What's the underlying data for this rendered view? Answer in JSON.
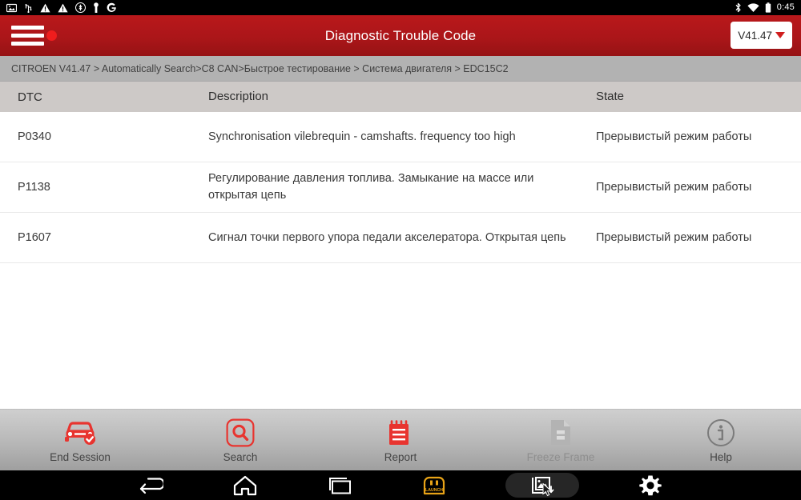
{
  "statusbar": {
    "time": "0:45",
    "left_icons": [
      "image-icon",
      "usb-icon",
      "warning-icon",
      "warning-icon",
      "bluetooth-off-icon",
      "key-icon",
      "google-icon"
    ],
    "right_icons": [
      "bluetooth-icon",
      "wifi-icon",
      "battery-icon"
    ]
  },
  "header": {
    "title": "Diagnostic Trouble Code",
    "menu_icon": "hamburger-icon",
    "version_label": "V41.47"
  },
  "breadcrumb": {
    "text": "CITROEN V41.47 > Automatically Search>C8 CAN>Быстрое тестирование > Система двигателя > EDC15C2"
  },
  "table": {
    "headers": {
      "dtc": "DTC",
      "description": "Description",
      "state": "State"
    },
    "rows": [
      {
        "dtc": "P0340",
        "description": "Synchronisation vilebrequin - camshafts. frequency too high",
        "state": "Прерывистый режим работы"
      },
      {
        "dtc": "P1138",
        "description": "Регулирование давления топлива. Замыкание на массе или открытая цепь",
        "state": "Прерывистый режим работы"
      },
      {
        "dtc": "P1607",
        "description": "Сигнал точки первого упора педали акселератора. Открытая цепь",
        "state": "Прерывистый режим работы"
      }
    ]
  },
  "toolbar": {
    "items": [
      {
        "label": "End Session",
        "icon": "car-check-icon",
        "enabled": true
      },
      {
        "label": "Search",
        "icon": "search-icon",
        "enabled": true
      },
      {
        "label": "Report",
        "icon": "report-icon",
        "enabled": true
      },
      {
        "label": "Freeze Frame",
        "icon": "freeze-frame-icon",
        "enabled": false
      },
      {
        "label": "Help",
        "icon": "info-icon",
        "enabled": true
      }
    ]
  },
  "navbar": {
    "items": [
      {
        "name": "back-icon"
      },
      {
        "name": "home-icon"
      },
      {
        "name": "recents-icon"
      },
      {
        "name": "launch-logo-icon"
      },
      {
        "name": "screenshot-icon"
      },
      {
        "name": "settings-gear-icon"
      }
    ]
  },
  "colors": {
    "brand_red": "#ab1619",
    "accent_red": "#e8342f",
    "breadcrumb_bg": "#b2b2b2",
    "table_header_bg": "#cdc9c7",
    "toolbar_bg": "#b7b7b7",
    "disabled_grey": "#b0b0b0"
  }
}
